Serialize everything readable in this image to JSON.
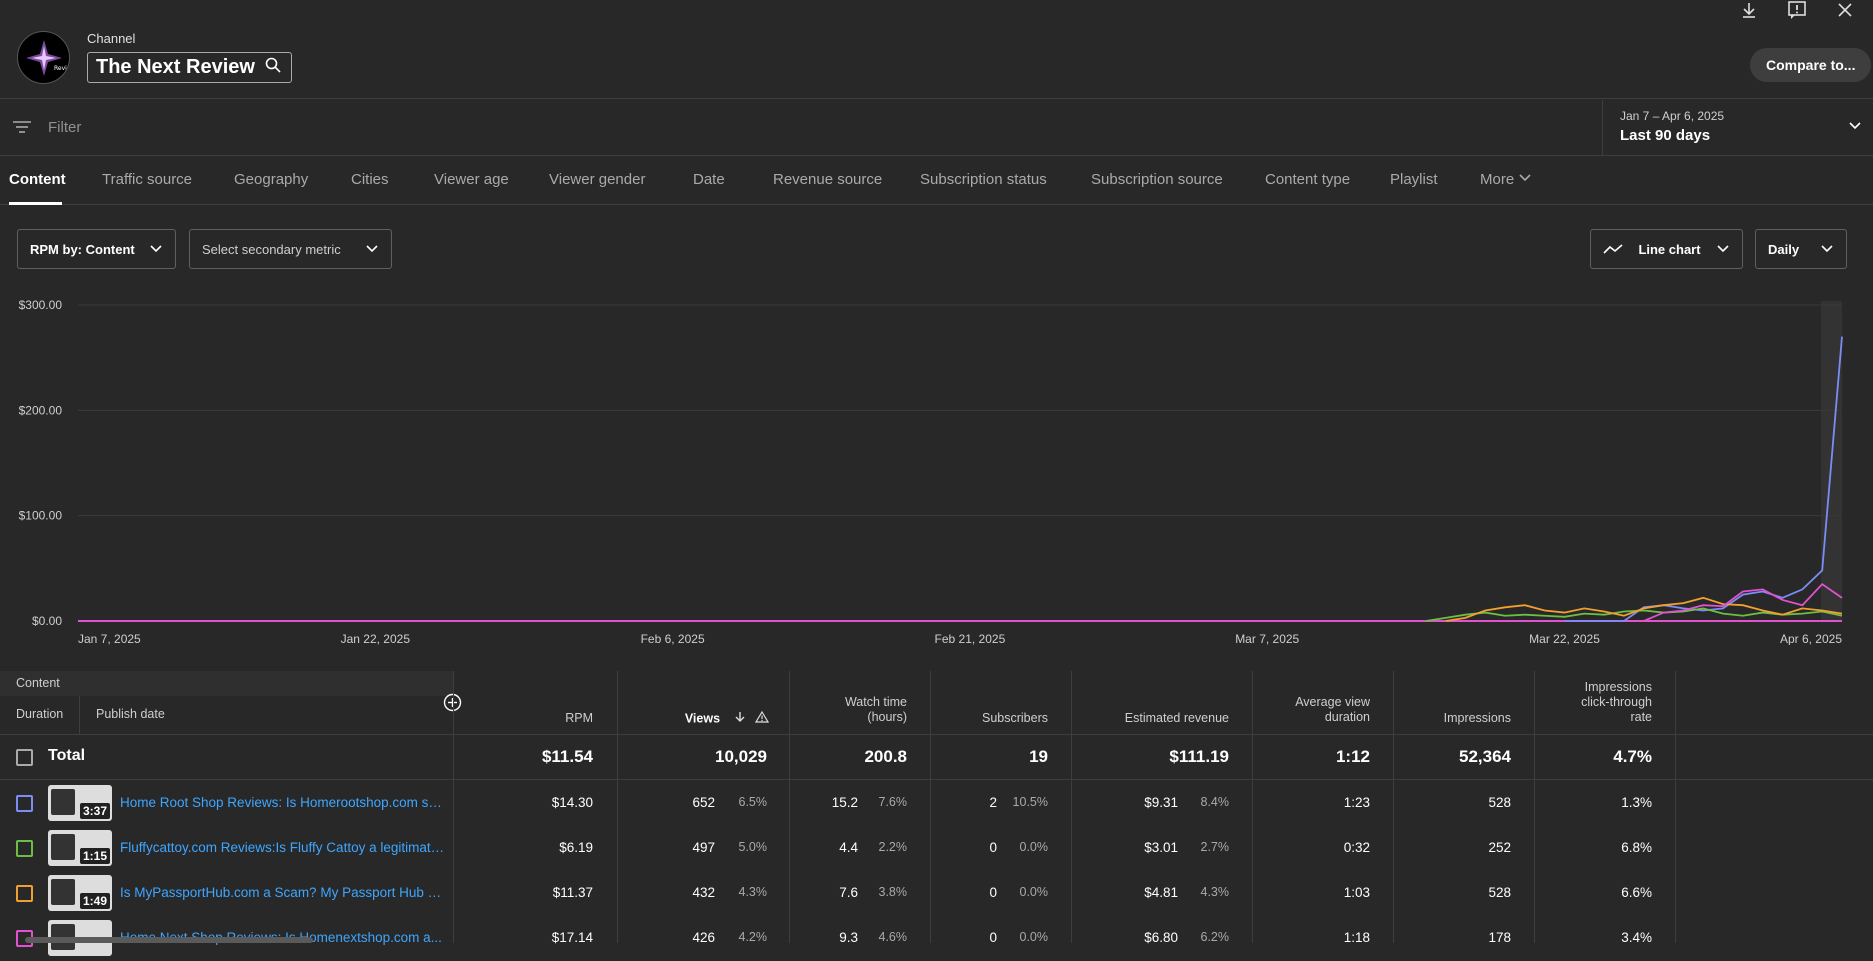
{
  "header": {
    "channel_label": "Channel",
    "channel_name": "The Next Review",
    "logo_text": "Review",
    "compare_button": "Compare to..."
  },
  "filter": {
    "placeholder": "Filter"
  },
  "date": {
    "range": "Jan 7 – Apr 6, 2025",
    "label": "Last 90 days"
  },
  "tabs": [
    "Content",
    "Traffic source",
    "Geography",
    "Cities",
    "Viewer age",
    "Viewer gender",
    "Date",
    "Revenue source",
    "Subscription status",
    "Subscription source",
    "Content type",
    "Playlist",
    "More"
  ],
  "controls": {
    "primary_metric": "RPM by: Content",
    "secondary_metric": "Select secondary metric",
    "chart_type": "Line chart",
    "granularity": "Daily"
  },
  "chart_data": {
    "type": "line",
    "ylim": [
      0,
      300
    ],
    "yticks": [
      "$300.00",
      "$200.00",
      "$100.00",
      "$0.00"
    ],
    "xticks": [
      "Jan 7, 2025",
      "Jan 22, 2025",
      "Feb 6, 2025",
      "Feb 21, 2025",
      "Mar 7, 2025",
      "Mar 22, 2025",
      "Apr 6, 2025"
    ],
    "days": 90,
    "series": [
      {
        "color": "#7b8cf7",
        "values": [
          [
            75,
            0
          ],
          [
            78,
            0
          ],
          [
            79,
            13
          ],
          [
            80,
            15
          ],
          [
            81,
            12
          ],
          [
            82,
            10
          ],
          [
            83,
            12
          ],
          [
            84,
            25
          ],
          [
            85,
            28
          ],
          [
            86,
            22
          ],
          [
            87,
            30
          ],
          [
            88,
            48
          ],
          [
            89,
            270
          ]
        ]
      },
      {
        "color": "#6cbf45",
        "values": [
          [
            68,
            0
          ],
          [
            69,
            3
          ],
          [
            70,
            6
          ],
          [
            71,
            8
          ],
          [
            72,
            5
          ],
          [
            73,
            6
          ],
          [
            74,
            5
          ],
          [
            75,
            4
          ],
          [
            76,
            7
          ],
          [
            77,
            6
          ],
          [
            78,
            9
          ],
          [
            79,
            10
          ],
          [
            80,
            8
          ],
          [
            81,
            9
          ],
          [
            82,
            12
          ],
          [
            83,
            7
          ],
          [
            84,
            5
          ],
          [
            85,
            8
          ],
          [
            86,
            6
          ],
          [
            87,
            7
          ],
          [
            88,
            9
          ],
          [
            89,
            5
          ]
        ]
      },
      {
        "color": "#f0a030",
        "values": [
          [
            69,
            0
          ],
          [
            70,
            3
          ],
          [
            71,
            10
          ],
          [
            72,
            13
          ],
          [
            73,
            15
          ],
          [
            74,
            10
          ],
          [
            75,
            8
          ],
          [
            76,
            12
          ],
          [
            77,
            9
          ],
          [
            78,
            5
          ],
          [
            79,
            12
          ],
          [
            80,
            15
          ],
          [
            81,
            17
          ],
          [
            82,
            22
          ],
          [
            83,
            16
          ],
          [
            84,
            15
          ],
          [
            85,
            10
          ],
          [
            86,
            6
          ],
          [
            87,
            12
          ],
          [
            88,
            10
          ],
          [
            89,
            7
          ]
        ]
      },
      {
        "color": "#e052d0",
        "values": [
          [
            79,
            0
          ],
          [
            80,
            8
          ],
          [
            81,
            10
          ],
          [
            82,
            15
          ],
          [
            83,
            14
          ],
          [
            84,
            28
          ],
          [
            85,
            30
          ],
          [
            86,
            20
          ],
          [
            87,
            15
          ],
          [
            88,
            35
          ],
          [
            89,
            22
          ]
        ]
      }
    ]
  },
  "table": {
    "content_label": "Content",
    "duration_label": "Duration",
    "publish_date_label": "Publish date",
    "columns": {
      "rpm": "RPM",
      "views": "Views",
      "watch_l1": "Watch time",
      "watch_l2": "(hours)",
      "subs": "Subscribers",
      "revenue": "Estimated revenue",
      "avd_l1": "Average view",
      "avd_l2": "duration",
      "impr": "Impressions",
      "ctr_l1": "Impressions",
      "ctr_l2": "click-through",
      "ctr_l3": "rate"
    },
    "total": {
      "label": "Total",
      "rpm": "$11.54",
      "views": "10,029",
      "watch": "200.8",
      "subs": "19",
      "revenue": "$111.19",
      "avd": "1:12",
      "impr": "52,364",
      "ctr": "4.7%"
    },
    "rows": [
      {
        "color": "#7b8cf7",
        "duration": "3:37",
        "title": "Home Root Shop Reviews: Is Homerootshop.com sca...",
        "rpm": "$14.30",
        "views": "652",
        "views_pct": "6.5%",
        "watch": "15.2",
        "watch_pct": "7.6%",
        "subs": "2",
        "subs_pct": "10.5%",
        "revenue": "$9.31",
        "revenue_pct": "8.4%",
        "avd": "1:23",
        "impr": "528",
        "ctr": "1.3%"
      },
      {
        "color": "#6cbf45",
        "duration": "1:15",
        "title": "Fluffycattoy.com Reviews:Is Fluffy Cattoy a legitimate ...",
        "rpm": "$6.19",
        "views": "497",
        "views_pct": "5.0%",
        "watch": "4.4",
        "watch_pct": "2.2%",
        "subs": "0",
        "subs_pct": "0.0%",
        "revenue": "$3.01",
        "revenue_pct": "2.7%",
        "avd": "0:32",
        "impr": "252",
        "ctr": "6.8%"
      },
      {
        "color": "#f0a030",
        "duration": "1:49",
        "title": "Is MyPassportHub.com a Scam? My Passport Hub Rev...",
        "rpm": "$11.37",
        "views": "432",
        "views_pct": "4.3%",
        "watch": "7.6",
        "watch_pct": "3.8%",
        "subs": "0",
        "subs_pct": "0.0%",
        "revenue": "$4.81",
        "revenue_pct": "4.3%",
        "avd": "1:03",
        "impr": "528",
        "ctr": "6.6%"
      },
      {
        "color": "#e052d0",
        "duration": "",
        "title": "Home Next Shop Reviews: Is Homenextshop.com a...",
        "rpm": "$17.14",
        "views": "426",
        "views_pct": "4.2%",
        "watch": "9.3",
        "watch_pct": "4.6%",
        "subs": "0",
        "subs_pct": "0.0%",
        "revenue": "$6.80",
        "revenue_pct": "6.2%",
        "avd": "1:18",
        "impr": "178",
        "ctr": "3.4%"
      }
    ]
  }
}
